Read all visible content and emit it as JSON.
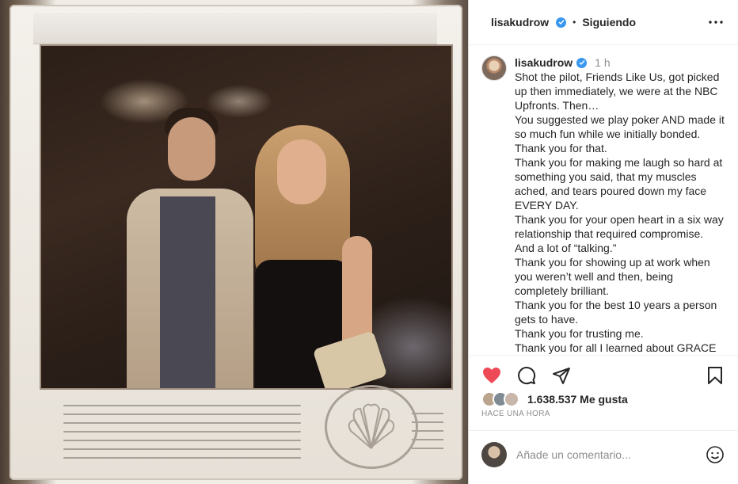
{
  "post": {
    "username": "lisakudrow",
    "separator": "•",
    "follow_state": "Siguiendo",
    "time_ago": "1 h",
    "caption_lines": [
      "Shot the pilot, Friends Like Us, got picked up then immediately, we were at the NBC Upfronts. Then…",
      "You suggested we play poker AND made it so much fun while we initially bonded.",
      "Thank you for that.",
      "Thank you for making me laugh so hard at something you said, that my muscles ached, and tears poured down my face EVERY DAY.",
      "Thank you for your open heart in a six way relationship that required compromise. And a lot of “talking.”",
      "Thank you for showing up at work when you weren’t well and then, being completely brilliant.",
      "Thank you for the best 10 years a person gets to have.",
      "Thank you for trusting me.",
      "Thank you for all I learned about GRACE"
    ],
    "likes": "1.638.537 Me gusta",
    "posted": "HACE UNA HORA",
    "comment_placeholder": "Añade un comentario..."
  },
  "colors": {
    "like_red": "#ed4956",
    "verified_blue": "#3897f0",
    "muted_text": "#8e8e8e"
  },
  "icons": [
    "heart-icon",
    "comment-icon",
    "share-icon",
    "bookmark-icon",
    "more-icon",
    "emoji-icon",
    "verified-icon",
    "nbc-peacock-icon"
  ]
}
